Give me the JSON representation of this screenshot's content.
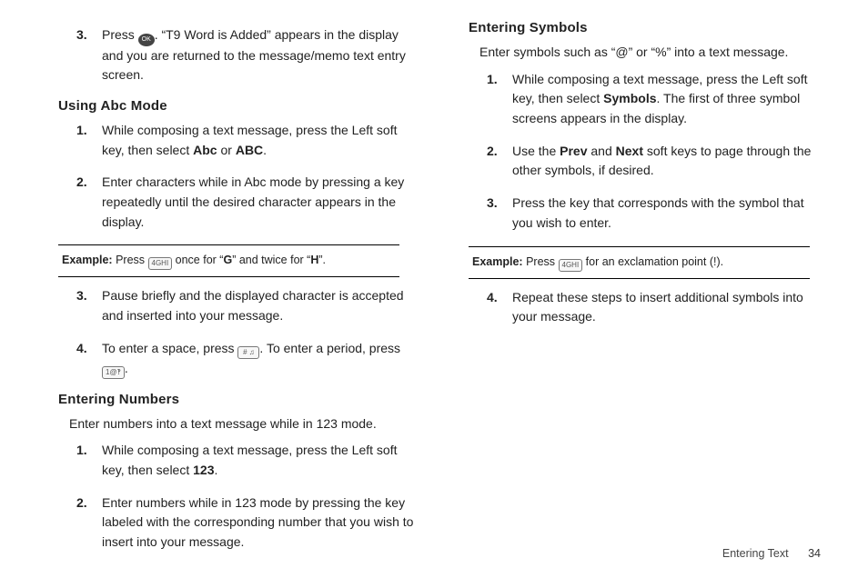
{
  "left": {
    "topStep": {
      "num": "3.",
      "press": "Press ",
      "okKey": "OK",
      "afterOk": ". “T9 Word is Added” appears in the display and you are returned to the message/memo text entry screen."
    },
    "abc": {
      "heading": "Using Abc Mode",
      "s1": {
        "num": "1.",
        "t1": "While composing a text message, press the Left soft key, then select ",
        "b1": "Abc",
        "t2": " or ",
        "b2": "ABC",
        "t3": "."
      },
      "s2": {
        "num": "2.",
        "text": "Enter characters while in Abc mode by pressing a key repeatedly until the desired character appears in the display."
      },
      "example": {
        "label": "Example:",
        "t1": " Press ",
        "key1": "4GHI",
        "t2": " once for “",
        "b1": "G",
        "t3": "” and twice for “",
        "b2": "H",
        "t4": "”."
      },
      "s3": {
        "num": "3.",
        "text": "Pause briefly and the displayed character is accepted and inserted into your message."
      },
      "s4": {
        "num": "4.",
        "t1": "To enter a space, press ",
        "key1": "# ♫",
        "t2": ". To enter a period, press ",
        "key2": "1@‽",
        "t3": "."
      }
    },
    "numbers": {
      "heading": "Entering Numbers",
      "intro": "Enter numbers into a text message while in 123 mode.",
      "s1": {
        "num": "1.",
        "t1": "While composing a text message, press the Left soft key, then select ",
        "b1": "123",
        "t2": "."
      },
      "s2": {
        "num": "2.",
        "text": "Enter numbers while in 123 mode by pressing the key labeled with the corresponding number that you wish to insert into your message."
      }
    }
  },
  "right": {
    "symbols": {
      "heading": "Entering Symbols",
      "intro": "Enter symbols such as “@” or “%” into a text message.",
      "s1": {
        "num": "1.",
        "t1": "While composing a text message, press the Left soft key, then select ",
        "b1": "Symbols",
        "t2": ". The first of three symbol screens appears in the display."
      },
      "s2": {
        "num": "2.",
        "t1": "Use the ",
        "b1": "Prev",
        "t2": " and ",
        "b2": "Next",
        "t3": " soft keys to page through the other symbols, if desired."
      },
      "s3": {
        "num": "3.",
        "text": "Press the key that corresponds with the symbol that you wish to enter."
      },
      "example": {
        "label": "Example:",
        "t1": " Press ",
        "key1": "4GHI",
        "t2": " for an exclamation point (!)."
      },
      "s4": {
        "num": "4.",
        "text": "Repeat these steps to insert additional symbols into your message."
      }
    }
  },
  "footer": {
    "section": "Entering Text",
    "page": "34"
  }
}
